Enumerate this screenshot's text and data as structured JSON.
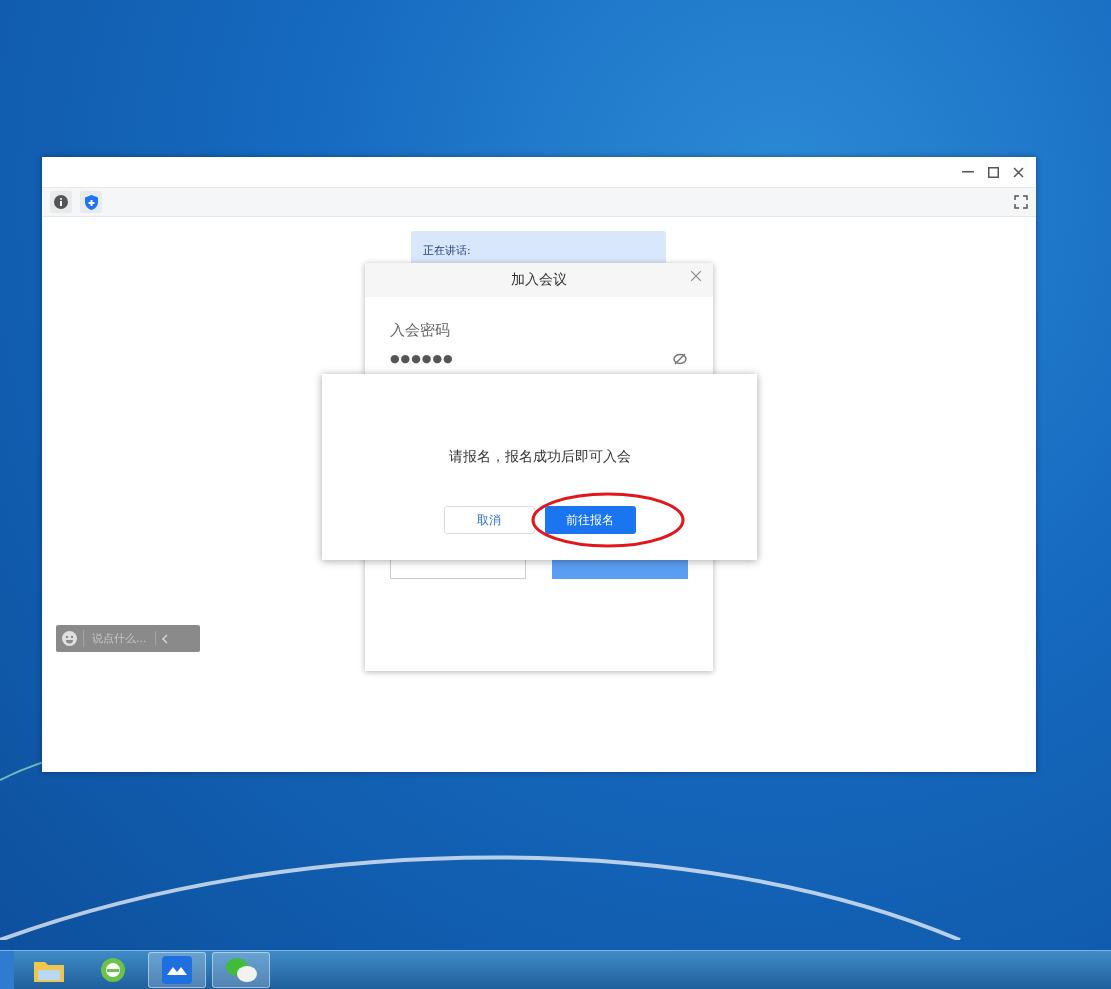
{
  "speaking_banner": {
    "label": "正在讲话:"
  },
  "join_dialog": {
    "title": "加入会议",
    "password_label": "入会密码",
    "password_value": "●●●●●●"
  },
  "prompt_dialog": {
    "message": "请报名，报名成功后即可入会",
    "buttons": [
      {
        "label": "取消",
        "kind": "secondary",
        "highlighted": false
      },
      {
        "label": "前往报名",
        "kind": "primary",
        "highlighted": true
      }
    ]
  },
  "chat_bar": {
    "placeholder": "说点什么..."
  },
  "taskbar": {
    "items": [
      {
        "kind": "explorer",
        "running": false
      },
      {
        "kind": "browser",
        "running": false
      },
      {
        "kind": "meeting",
        "running": true
      },
      {
        "kind": "chat",
        "running": true
      }
    ]
  }
}
